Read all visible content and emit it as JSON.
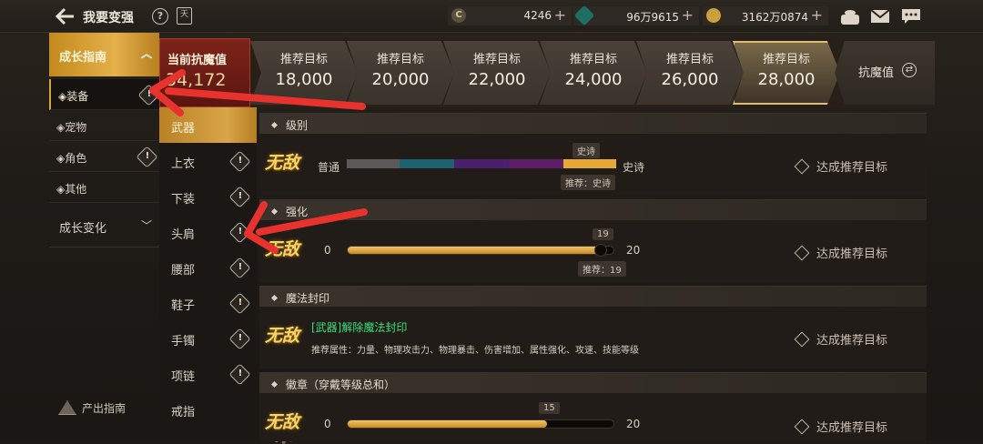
{
  "header": {
    "title": "我要变强",
    "help_icon": "?",
    "calendar_icon": "天",
    "currencies": [
      {
        "icon": "coin-icon",
        "glyph": "C",
        "value": "4246"
      },
      {
        "icon": "gem-icon",
        "glyph": "◆",
        "value": "96万9615"
      },
      {
        "icon": "gold-icon",
        "glyph": "●",
        "value": "3162万0874"
      }
    ],
    "plus": "+"
  },
  "leftnav": {
    "section1": "成长指南",
    "items": [
      "◈装备",
      "◈宠物",
      "◈角色",
      "◈其他"
    ],
    "selected": "◈装备",
    "section2": "成长变化",
    "output_guide": "产出指南"
  },
  "subnav": {
    "items": [
      "武器",
      "上衣",
      "下装",
      "头肩",
      "腰部",
      "鞋子",
      "手镯",
      "项链",
      "戒指"
    ],
    "selected": "武器"
  },
  "targets": {
    "current_label": "当前抗魔值",
    "current_value": "34,172",
    "items": [
      {
        "label": "推荐目标",
        "value": "18,000"
      },
      {
        "label": "推荐目标",
        "value": "20,000"
      },
      {
        "label": "推荐目标",
        "value": "22,000"
      },
      {
        "label": "推荐目标",
        "value": "24,000"
      },
      {
        "label": "推荐目标",
        "value": "26,000"
      },
      {
        "label": "推荐目标",
        "value": "28,000"
      }
    ],
    "resist_button": "抗魔值"
  },
  "panels": {
    "grade": {
      "title": "级别",
      "badge": "无敌",
      "left": "普通",
      "right": "史诗",
      "tag": "史诗",
      "recommend": "推荐：史诗",
      "achieve": "达成推荐目标"
    },
    "enhance": {
      "title": "强化",
      "badge": "无敌",
      "min": "0",
      "max": "20",
      "current": "19",
      "current_value": 19,
      "recommend": "推荐：19",
      "achieve": "达成推荐目标"
    },
    "magic": {
      "title": "魔法封印",
      "badge": "无敌",
      "text": "[武器]解除魔法封印",
      "attrs": "推荐属性：力量、物理攻击力、物理暴击、伤害增加、属性强化、攻速、技能等级",
      "achieve": "达成推荐目标"
    },
    "emblem": {
      "title": "徽章（穿戴等级总和）",
      "badge": "无敌",
      "min": "0",
      "max": "20",
      "current": "15",
      "current_value": 15,
      "achieve": "达成推荐目标"
    }
  },
  "colors": {
    "gold": "#d6a43c",
    "current_bg": "#7d231a",
    "green_text": "#39e07a",
    "arrow_red": "#e8322e"
  }
}
